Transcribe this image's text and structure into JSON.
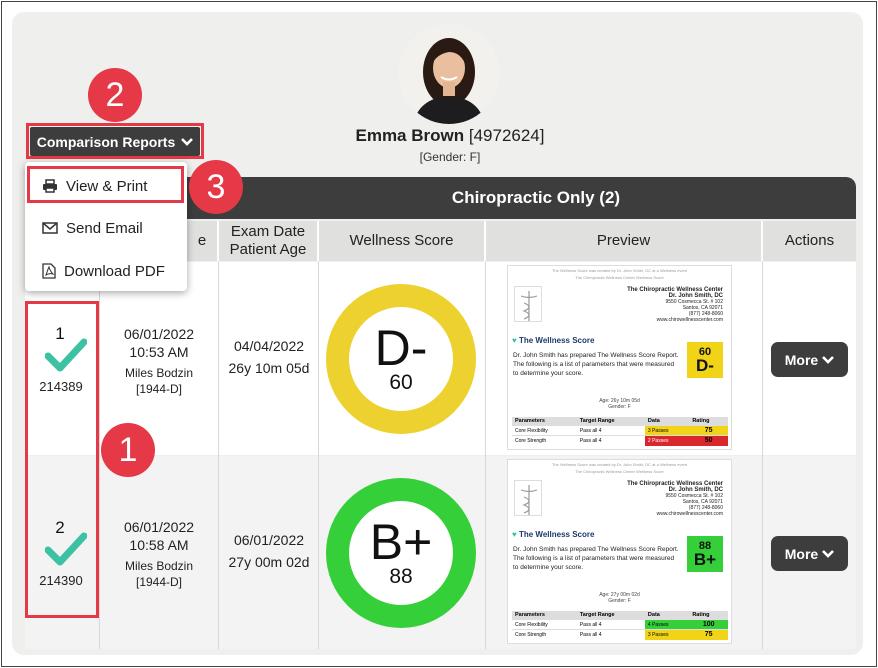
{
  "patient": {
    "name": "Emma Brown",
    "id": "[4972624]",
    "gender": "[Gender: F]"
  },
  "comparison_button": {
    "label": "Comparison Reports"
  },
  "menu": {
    "items": [
      {
        "label": "View & Print",
        "icon": "printer-icon"
      },
      {
        "label": "Send Email",
        "icon": "envelope-icon"
      },
      {
        "label": "Download PDF",
        "icon": "pdf-file-icon"
      }
    ]
  },
  "callouts": [
    "1",
    "2",
    "3"
  ],
  "group": {
    "title": "Chiropractic Only (2)"
  },
  "columns": {
    "date": "e",
    "exam": "Exam Date\nPatient Age",
    "wellness": "Wellness Score",
    "preview": "Preview",
    "actions": "Actions"
  },
  "rows": [
    {
      "index": "1",
      "id": "214389",
      "date": "06/01/2022",
      "time": "10:53 AM",
      "doctor": "Miles Bodzin",
      "doctor_code": "[1944-D]",
      "exam_date": "04/04/2022",
      "age": "26y 10m 05d",
      "grade": "D-",
      "score": "60",
      "ring_color": "#ecd12f",
      "preview": {
        "age": "Age: 26y 10m 05d",
        "gender": "Gender: F",
        "rows": [
          {
            "param": "Core Flexibility",
            "range": "Pass all 4",
            "data": "3 Passes",
            "rating": "75",
            "color": "#f1d417"
          },
          {
            "param": "Core Strength",
            "range": "Pass all 4",
            "data": "2 Passes",
            "rating": "50",
            "color": "#d9272e"
          }
        ]
      }
    },
    {
      "index": "2",
      "id": "214390",
      "date": "06/01/2022",
      "time": "10:58 AM",
      "doctor": "Miles Bodzin",
      "doctor_code": "[1944-D]",
      "exam_date": "06/01/2022",
      "age": "27y 00m 02d",
      "grade": "B+",
      "score": "88",
      "ring_color": "#35cf39",
      "preview": {
        "age": "Age: 27y 00m 02d",
        "gender": "Gender: F",
        "rows": [
          {
            "param": "Core Flexibility",
            "range": "Pass all 4",
            "data": "4 Passes",
            "rating": "100",
            "color": "#35cf39"
          },
          {
            "param": "Core Strength",
            "range": "Pass all 4",
            "data": "3 Passes",
            "rating": "75",
            "color": "#f1d417"
          }
        ]
      }
    }
  ],
  "preview_common": {
    "top_line1": "The Wellness Score was created by Dr. John Smith, DC at a Wellness event",
    "top_line2": "The Chiropractic Wellness Center Wellness Score",
    "clinic_name": "The Chiropractic Wellness Center",
    "doctor": "Dr. John Smith, DC",
    "address1": "9550 Cosmecca St. # 102",
    "address2": "Santos, CA 92071",
    "phone": "(877) 248-8060",
    "web": "www.chirowellnesscenter.com",
    "title": "The Wellness Score",
    "text": "Dr. John Smith has prepared The Wellness Score Report. The following is a list of parameters that were measured to determine your score.",
    "headers": [
      "Parameters",
      "Target Range",
      "Data",
      "Rating"
    ]
  },
  "more_label": "More"
}
